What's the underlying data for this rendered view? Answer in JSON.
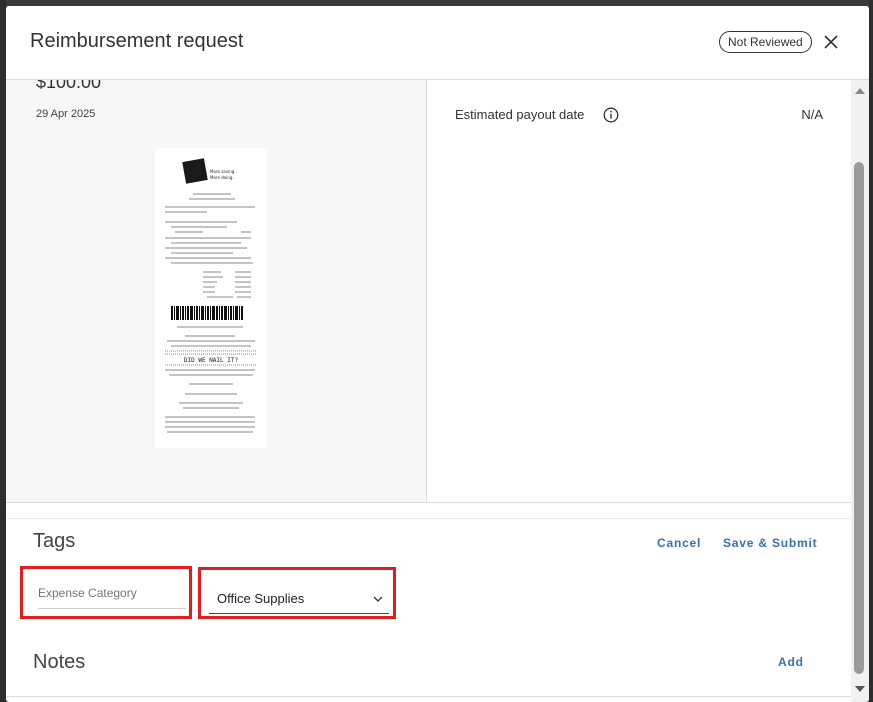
{
  "dialog": {
    "title": "Reimbursement request",
    "status_badge": "Not Reviewed",
    "close_icon": "close-icon"
  },
  "summary": {
    "amount": "$100.00",
    "date": "29 Apr 2025"
  },
  "receipt": {
    "image": "receipt-image",
    "logo_text_1": "More saving.",
    "logo_text_2": "More doing.",
    "footer_text": "DID WE NAIL IT?"
  },
  "details": {
    "payout_label": "Estimated payout date",
    "payout_info_icon": "info-icon",
    "payout_value": "N/A"
  },
  "tags": {
    "title": "Tags",
    "cancel_label": "Cancel",
    "save_label": "Save & Submit",
    "expense_category_placeholder": "Expense Category",
    "category_value": "Office Supplies",
    "dropdown_icon": "chevron-down-icon"
  },
  "notes": {
    "title": "Notes",
    "add_label": "Add"
  },
  "colors": {
    "accent": "#3a6fb5",
    "highlight": "#e31d1d"
  }
}
